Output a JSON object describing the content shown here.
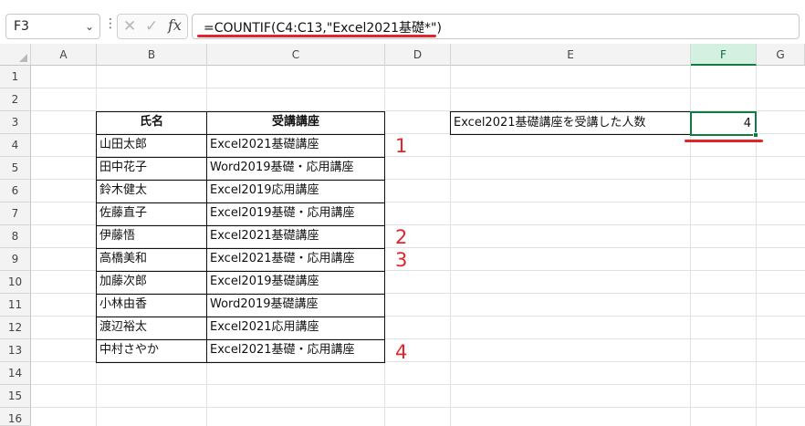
{
  "formula_bar": {
    "name_box": "F3",
    "name_box_arrow": "⌄",
    "more_dots": "⋮",
    "cancel_icon": "✕",
    "enter_icon": "✓",
    "fx_label": "fx",
    "formula": "=COUNTIF(C4:C13,\"Excel2021基礎*\")"
  },
  "columns": [
    "A",
    "B",
    "C",
    "D",
    "E",
    "F",
    "G"
  ],
  "selected_column": "F",
  "rows": [
    "1",
    "2",
    "3",
    "4",
    "5",
    "6",
    "7",
    "8",
    "9",
    "10",
    "11",
    "12",
    "13",
    "14",
    "15",
    "16"
  ],
  "table": {
    "headers": [
      "氏名",
      "受講講座"
    ],
    "rows": [
      [
        "山田太郎",
        "Excel2021基礎講座"
      ],
      [
        "田中花子",
        "Word2019基礎・応用講座"
      ],
      [
        "鈴木健太",
        "Excel2019応用講座"
      ],
      [
        "佐藤直子",
        "Excel2019基礎・応用講座"
      ],
      [
        "伊藤悟",
        "Excel2021基礎講座"
      ],
      [
        "高橋美和",
        "Excel2021基礎・応用講座"
      ],
      [
        "加藤次郎",
        "Excel2019基礎講座"
      ],
      [
        "小林由香",
        "Word2019基礎講座"
      ],
      [
        "渡辺裕太",
        "Excel2021応用講座"
      ],
      [
        "中村さやか",
        "Excel2021基礎・応用講座"
      ]
    ]
  },
  "result_label": "Excel2021基礎講座を受講した人数",
  "result_value": "4",
  "annotations": [
    "1",
    "2",
    "3",
    "4"
  ],
  "colors": {
    "accent_green": "#107c41",
    "annotation_red": "#e3242b"
  }
}
